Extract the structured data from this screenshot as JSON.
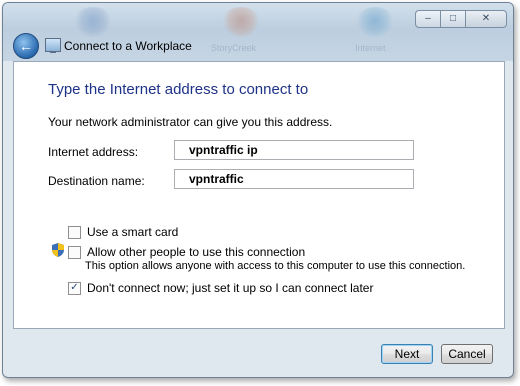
{
  "window": {
    "title": "Connect to a Workplace",
    "caption_buttons": {
      "minimize": "–",
      "maximize": "□",
      "close": "✕"
    },
    "background_labels": [
      "StoryCreek",
      "Internet"
    ]
  },
  "page": {
    "heading": "Type the Internet address to connect to",
    "instruction": "Your network administrator can give you this address."
  },
  "form": {
    "internet_address": {
      "label": "Internet address:",
      "value": "vpntraffic ip"
    },
    "destination_name": {
      "label": "Destination name:",
      "value": "vpntraffic"
    }
  },
  "options": {
    "smart_card": {
      "label": "Use a smart card",
      "checked": false
    },
    "allow_others": {
      "label": "Allow other people to use this connection",
      "checked": false,
      "note": "This option allows anyone with access to this computer to use this connection."
    },
    "dont_connect": {
      "label": "Don't connect now; just set it up so I can connect later",
      "checked": true,
      "mark": "✓"
    }
  },
  "buttons": {
    "next": "Next",
    "cancel": "Cancel"
  },
  "icons": {
    "back": "back-arrow-icon",
    "title": "workplace-network-icon",
    "shield": "uac-shield-icon"
  },
  "colors": {
    "heading": "#1e3287",
    "accent": "#3c7fb1"
  }
}
